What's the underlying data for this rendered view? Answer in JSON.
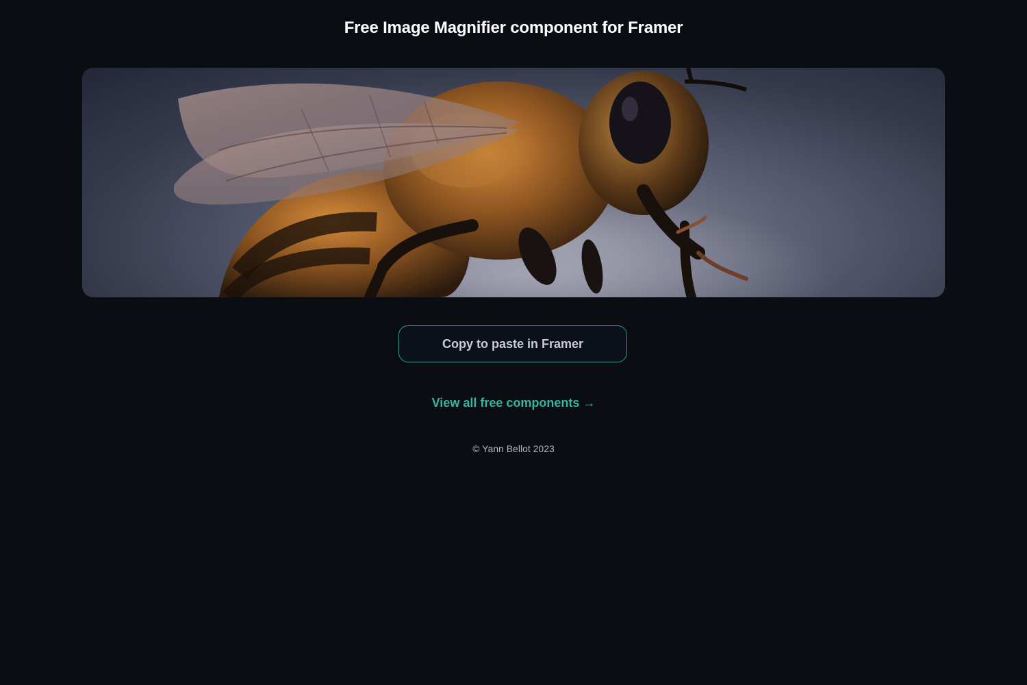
{
  "header": {
    "title": "Free Image Magnifier component for Framer"
  },
  "image": {
    "subject": "bee-closeup-photo"
  },
  "actions": {
    "copy_label": "Copy to paste in Framer",
    "view_all_label": "View all free components →"
  },
  "footer": {
    "copyright": "© Yann Bellot 2023"
  },
  "colors": {
    "background": "#0a0d12",
    "accent": "#34b6a1",
    "button_border": "#2f9c8d"
  }
}
